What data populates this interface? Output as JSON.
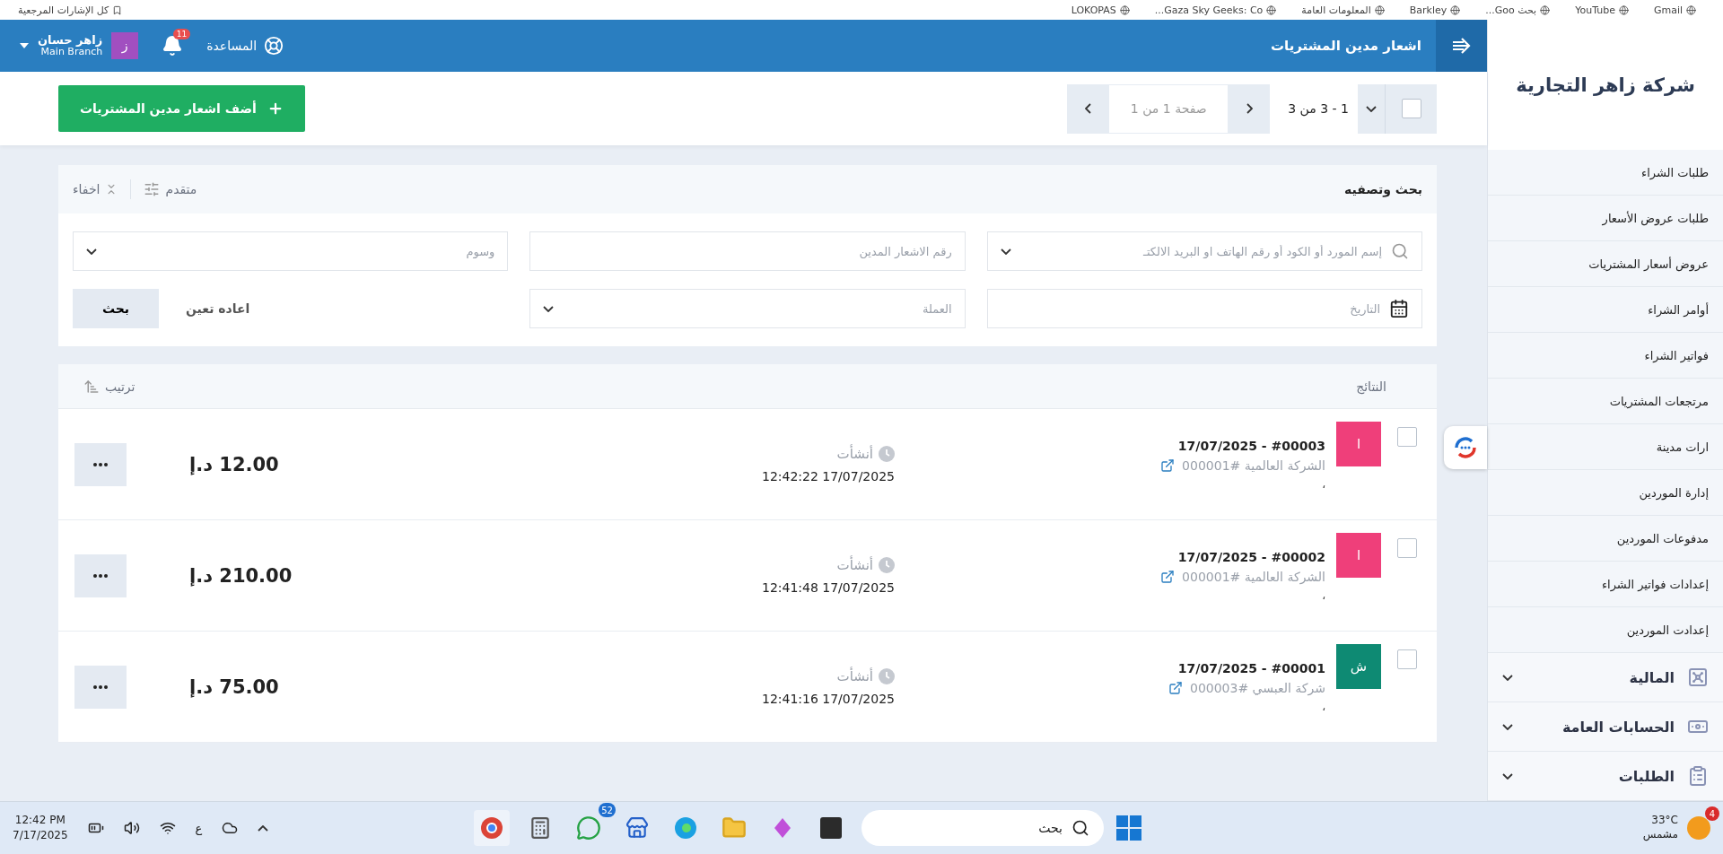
{
  "bookmarks": [
    {
      "label": "Gmail"
    },
    {
      "label": "YouTube"
    },
    {
      "label": "بحث Goo..."
    },
    {
      "label": "Barkley"
    },
    {
      "label": "المعلومات العامة"
    },
    {
      "label": "Gaza Sky Geeks: Co..."
    },
    {
      "label": "LOKOPAS"
    }
  ],
  "bookmarks_all": "كل الإشارات المرجعية",
  "company": "شركة زاهر التجارية",
  "sidebar": {
    "items": [
      {
        "label": "طلبات الشراء"
      },
      {
        "label": "طلبات عروض الأسعار"
      },
      {
        "label": "عروض أسعار المشتريات"
      },
      {
        "label": "أوامر الشراء"
      },
      {
        "label": "فواتير الشراء"
      },
      {
        "label": "مرتجعات المشتريات"
      },
      {
        "label": "ارات مدينة",
        "covered": true
      },
      {
        "label": "إدارة الموردين"
      },
      {
        "label": "مدفوعات الموردين"
      },
      {
        "label": "إعدادات فواتير الشراء"
      },
      {
        "label": "إعدادت الموردين"
      }
    ],
    "groups": [
      {
        "label": "المالية",
        "kind": "safe",
        "expanded": false
      },
      {
        "label": "الحسابات العامة",
        "kind": "money",
        "expanded": false
      },
      {
        "label": "الطلبات",
        "kind": "clipboard",
        "expanded": false
      }
    ]
  },
  "header": {
    "title": "اشعار مدين المشتريات",
    "help": "المساعدة",
    "notifications": "11",
    "user": {
      "initial": "ز",
      "name": "زاهر حسان",
      "branch": "Main Branch"
    }
  },
  "toolbar": {
    "select_all": {
      "checked": false
    },
    "range": "1 - 3 من 3",
    "page": "صفحة 1 من 1",
    "add_button": "أضف اشعار مدين المشتريات"
  },
  "filters": {
    "title": "بحث وتصفيه",
    "advanced": "متقدم",
    "hide": "اخفاء",
    "fields": [
      {
        "kind": "search",
        "placeholder": "إسم المورد أو الكود أو رقم الهاتف او البريد الالكتـ"
      },
      {
        "kind": "text",
        "placeholder": "رقم الاشعار المدين"
      },
      {
        "kind": "select",
        "placeholder": "وسوم"
      },
      {
        "kind": "date",
        "placeholder": "التاريخ"
      },
      {
        "kind": "select",
        "placeholder": "العملة"
      }
    ],
    "reset": "اعاده تعين",
    "search_button": "بحث"
  },
  "results": {
    "title": "النتائج",
    "sort": "ترتيب",
    "rows": [
      {
        "checked": false,
        "badge": "ا",
        "color": "#ef3f7a",
        "title": "17/07/2025 - #00003",
        "supplier": "الشركة العالمية #000001",
        "note": "،",
        "created_label": "أنشأت",
        "created": "12:42:22 17/07/2025",
        "amount": "12.00 د.إ"
      },
      {
        "checked": false,
        "badge": "ا",
        "color": "#ef3f7a",
        "title": "17/07/2025 - #00002",
        "supplier": "الشركة العالمية #000001",
        "note": "،",
        "created_label": "أنشأت",
        "created": "12:41:48 17/07/2025",
        "amount": "210.00 د.إ"
      },
      {
        "checked": false,
        "badge": "ش",
        "color": "#0e8a73",
        "title": "17/07/2025 - #00001",
        "supplier": "شركة العبسي #000003",
        "note": "،",
        "created_label": "أنشأت",
        "created": "12:41:16 17/07/2025",
        "amount": "75.00 د.إ"
      }
    ]
  },
  "taskbar": {
    "weather": {
      "temp": "33°C",
      "condition": "مشمس",
      "badge": "4"
    },
    "search": "بحث",
    "whatsapp_badge": "52",
    "language": "ع",
    "time": "12:42 PM",
    "date": "7/17/2025"
  }
}
